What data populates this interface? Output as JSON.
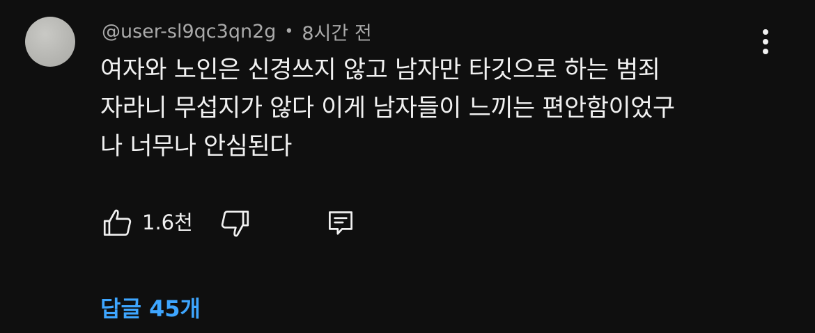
{
  "comment": {
    "author": "@user-sl9qc3qn2g",
    "separator": "•",
    "time": "8시간 전",
    "lines": [
      "여자와 노인은 신경쓰지 않고 남자만 타깃으로 하는 범죄",
      "자라니 무섭지가 않다 이게 남자들이 느끼는 편안함이었구",
      "나 너무나 안심된다"
    ],
    "like_count": "1.6천",
    "replies_label": "답글 45개"
  },
  "icons": {
    "avatar": "user-avatar",
    "like": "thumbs-up-icon",
    "dislike": "thumbs-down-icon",
    "reply": "comment-reply-icon",
    "more": "more-vertical-icon"
  },
  "colors": {
    "background": "#0f0f0f",
    "text": "#f1f1f1",
    "secondary_text": "#aaaaaa",
    "link": "#3ea6ff"
  }
}
